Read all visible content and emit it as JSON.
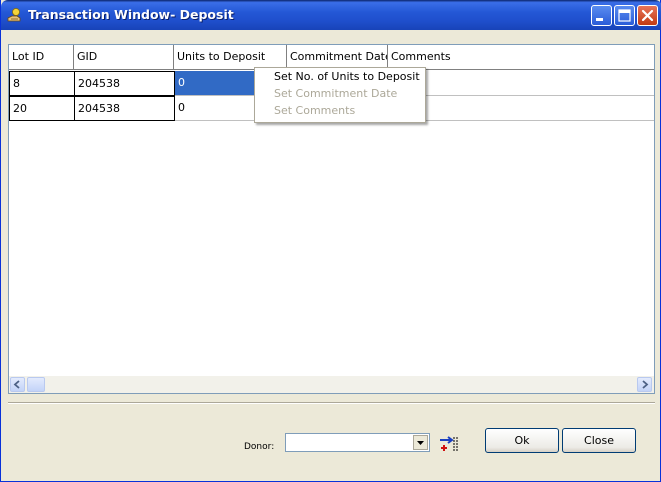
{
  "window": {
    "title": "Transaction Window- Deposit"
  },
  "colors": {
    "titlebar": "#2458d6",
    "selection": "#316ac5",
    "disabled_text": "#aca899",
    "window_bg": "#ece9d8"
  },
  "grid": {
    "columns": [
      "Lot ID",
      "GID",
      "Units to Deposit",
      "Commitment Date",
      "Comments"
    ],
    "rows": [
      {
        "lot_id": "8",
        "gid": "204538",
        "units": "0",
        "commitment_date": "",
        "comments": ""
      },
      {
        "lot_id": "20",
        "gid": "204538",
        "units": "0",
        "commitment_date": "",
        "comments": ""
      }
    ]
  },
  "context_menu": {
    "items": [
      {
        "label": "Set No. of Units to Deposit",
        "enabled": true
      },
      {
        "label": "Set Commitment Date",
        "enabled": false
      },
      {
        "label": "Set Comments",
        "enabled": false
      }
    ]
  },
  "footer": {
    "donor_label": "Donor:",
    "donor_value": "",
    "ok_label": "Ok",
    "close_label": "Close"
  },
  "icons": {
    "app": "hand-coin-icon",
    "minimize": "minimize-icon",
    "maximize": "maximize-icon",
    "close": "close-icon",
    "combo_arrow": "chevron-down-icon",
    "donor_action": "add-list-icon"
  }
}
